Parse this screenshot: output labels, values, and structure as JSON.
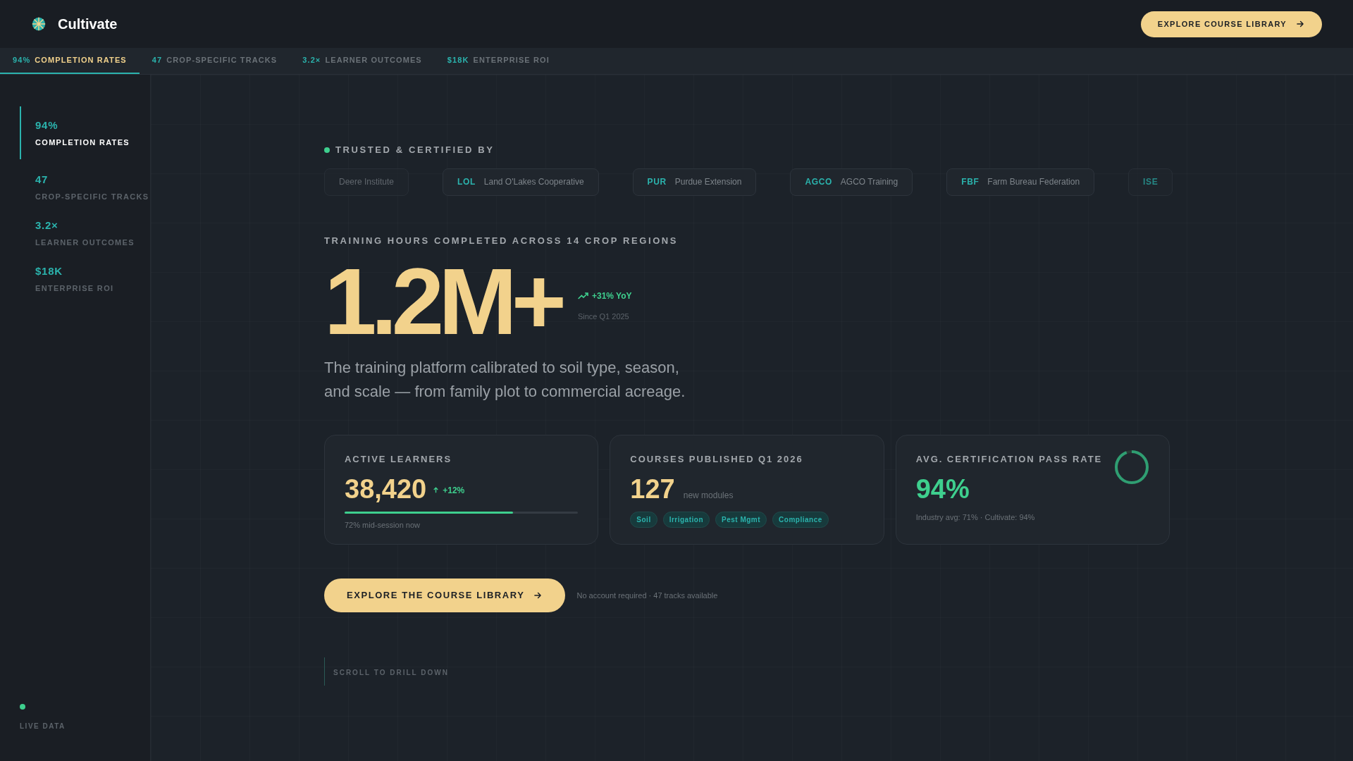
{
  "header": {
    "brand": "Cultivate",
    "cta": "EXPLORE COURSE LIBRARY"
  },
  "tabs": [
    {
      "value": "94%",
      "label": "COMPLETION RATES",
      "selected": true
    },
    {
      "value": "47",
      "label": "CROP-SPECIFIC TRACKS",
      "selected": false
    },
    {
      "value": "3.2×",
      "label": "LEARNER OUTCOMES",
      "selected": false
    },
    {
      "value": "$18K",
      "label": "ENTERPRISE ROI",
      "selected": false
    }
  ],
  "sidebar": {
    "items": [
      {
        "value": "94%",
        "label": "COMPLETION RATES",
        "selected": true
      },
      {
        "value": "47",
        "label": "CROP-SPECIFIC TRACKS",
        "selected": false
      },
      {
        "value": "3.2×",
        "label": "LEARNER OUTCOMES",
        "selected": false
      },
      {
        "value": "$18K",
        "label": "ENTERPRISE ROI",
        "selected": false
      }
    ],
    "live_label": "LIVE DATA"
  },
  "trusted": {
    "title": "TRUSTED & CERTIFIED BY",
    "partners": [
      {
        "name": "Deere Institute",
        "faded": true
      },
      {
        "abbr": "LOL",
        "name": "Land O'Lakes Cooperative",
        "faded": false
      },
      {
        "abbr": "PUR",
        "name": "Purdue Extension",
        "faded": false
      },
      {
        "abbr": "AGCO",
        "name": "AGCO Training",
        "faded": false
      },
      {
        "abbr": "FBF",
        "name": "Farm Bureau Federation",
        "faded": false
      },
      {
        "abbr": "ISE",
        "faded": true
      }
    ]
  },
  "hero": {
    "eyebrow": "TRAINING HOURS COMPLETED ACROSS 14 CROP REGIONS",
    "big_number": "1.2M+",
    "trend": "+31% YoY",
    "since": "Since Q1 2025",
    "description": "The training platform calibrated to soil type, season, and scale — from family plot to commercial acreage."
  },
  "cards": [
    {
      "kind": "progress",
      "title": "ACTIVE LEARNERS",
      "value": "38,420",
      "delta": "+12%",
      "level": 0.72,
      "note": "72% mid-session now"
    },
    {
      "kind": "tags",
      "title": "COURSES PUBLISHED Q1 2026",
      "value": "127",
      "unit": "new modules",
      "tags": [
        "Soil",
        "Irrigation",
        "Pest Mgmt",
        "Compliance"
      ]
    },
    {
      "kind": "ring",
      "title": "AVG. CERTIFICATION PASS RATE",
      "value": "94%",
      "level": 0.94,
      "note": "Industry avg: 71% · Cultivate: 94%"
    }
  ],
  "cta": {
    "button": "EXPLORE THE COURSE LIBRARY",
    "note": "No account required · 47 tracks available"
  },
  "scroll_hint": "SCROLL TO DRILL DOWN"
}
